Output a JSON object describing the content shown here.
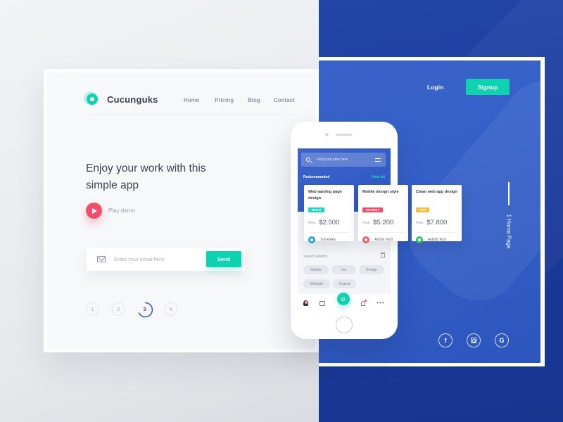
{
  "brand": {
    "name": "Cucunguks",
    "accent": "#0fd2b1"
  },
  "nav": {
    "items": [
      "Home",
      "Pricing",
      "Blog",
      "Contact"
    ]
  },
  "hero": {
    "headline": "Enjoy your work with this simple app",
    "play_label": "Play demo",
    "play_color": "#f04e6b"
  },
  "email_form": {
    "placeholder": "Enter your email here",
    "value": "",
    "send_label": "Send"
  },
  "pagination": {
    "steps": [
      "1",
      "2",
      "3",
      "4"
    ],
    "active_step": 3
  },
  "header_right": {
    "login_label": "Login",
    "signup_label": "Signup"
  },
  "page_indicator": {
    "label": "1 Home Page"
  },
  "socials": [
    {
      "name": "facebook",
      "glyph": "f"
    },
    {
      "name": "instagram",
      "glyph": ""
    },
    {
      "name": "google",
      "glyph": "G"
    }
  ],
  "phone": {
    "search_placeholder": "Find your jobs here",
    "recommended_label": "Redommanded",
    "view_all_label": "View all",
    "search_history_label": "Search History",
    "history_chips": [
      "Mobile",
      "Ios",
      "Design",
      "Website",
      "Urgent"
    ],
    "tabbar": [
      "profile",
      "inbox",
      "search",
      "notifications",
      "more"
    ]
  },
  "jobs": [
    {
      "title": "Web landing page design",
      "badge": "OPEN",
      "badge_color": "#1ed7c0",
      "price_label": "Price",
      "price": "$2.500",
      "company": "Traveloka",
      "company_color": "#2d9cdb"
    },
    {
      "title": "Mobile design style",
      "badge": "URGENT",
      "badge_color": "#f04e6b",
      "price_label": "Price",
      "price": "$5.200",
      "company": "Airbnb Tech",
      "company_color": "#f25b68"
    },
    {
      "title": "Clean web app design",
      "badge": "TOP",
      "badge_color": "#fbbf3c",
      "price_label": "Price",
      "price": "$7.800",
      "company": "Airbnb Tech",
      "company_color": "#24c65a"
    }
  ]
}
